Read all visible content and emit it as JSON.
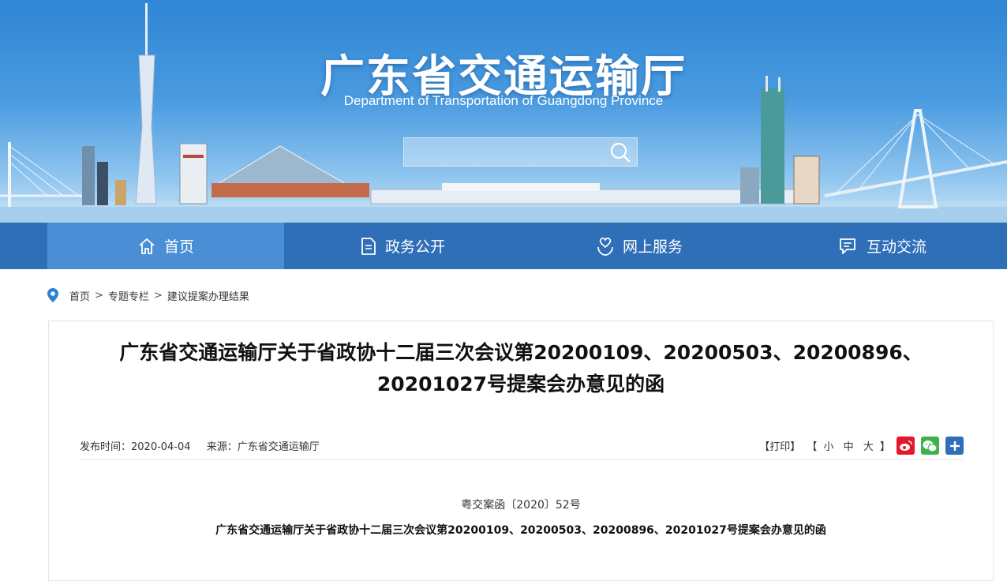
{
  "header": {
    "title": "广东省交通运输厅",
    "subtitle": "Department of Transportation of Guangdong Province",
    "search_placeholder": "",
    "search_icon": "search-icon"
  },
  "nav": {
    "items": [
      {
        "label": "首页",
        "icon": "home-icon"
      },
      {
        "label": "政务公开",
        "icon": "document-icon"
      },
      {
        "label": "网上服务",
        "icon": "heart-hand-icon"
      },
      {
        "label": "互动交流",
        "icon": "chat-icon"
      }
    ]
  },
  "breadcrumb": {
    "icon": "location-pin-icon",
    "items": [
      "首页",
      "专题专栏",
      "建议提案办理结果"
    ],
    "separator": ">"
  },
  "article": {
    "title_line1": "广东省交通运输厅关于省政协十二届三次会议第20200109、20200503、20200896、",
    "title_line2": "20201027号提案会办意见的函",
    "publish_time_label": "发布时间：",
    "publish_time": "2020-04-04",
    "source_label": "来源：",
    "source": "广东省交通运输厅",
    "print": "【打印】",
    "font_size_open": "【",
    "font_small": "小",
    "font_medium": "中",
    "font_large": "大",
    "font_size_close": "】",
    "doc_number": "粤交案函〔2020〕52号",
    "doc_title": "广东省交通运输厅关于省政协十二届三次会议第20200109、20200503、20200896、20201027号提案会办意见的函"
  },
  "share": {
    "buttons": [
      {
        "name": "weibo",
        "color": "#e6162d"
      },
      {
        "name": "wechat",
        "color": "#3fb14b"
      },
      {
        "name": "more",
        "color": "#2f6fb8"
      }
    ]
  },
  "colors": {
    "nav_bg": "#2f6fb8",
    "nav_active": "#4a8fd6",
    "banner_top": "#2f86d4"
  }
}
